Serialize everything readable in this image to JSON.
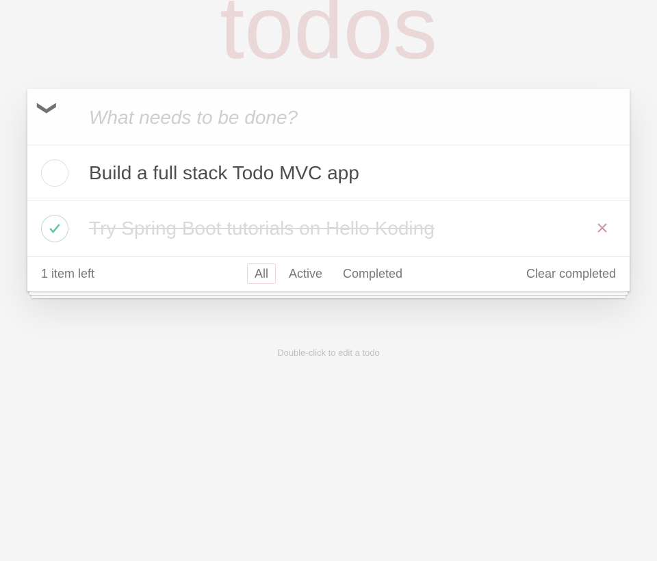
{
  "header": {
    "title": "todos",
    "input_placeholder": "What needs to be done?"
  },
  "todos": [
    {
      "text": "Build a full stack Todo MVC app",
      "completed": false,
      "hovered": false
    },
    {
      "text": "Try Spring Boot tutorials on Hello Koding",
      "completed": true,
      "hovered": true
    }
  ],
  "footer": {
    "count_text": "1 item left",
    "filters": {
      "all": "All",
      "active": "Active",
      "completed": "Completed",
      "selected": "all"
    },
    "clear_completed": "Clear completed"
  },
  "info": {
    "hint": "Double-click to edit a todo"
  }
}
